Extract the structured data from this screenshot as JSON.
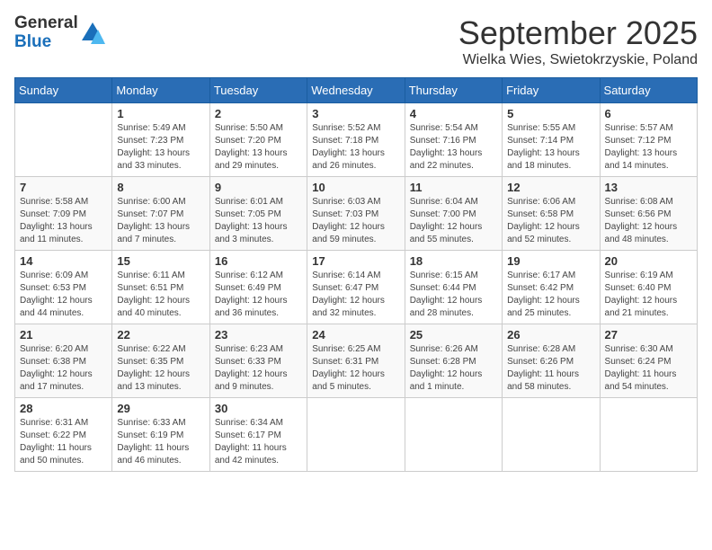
{
  "header": {
    "logo_general": "General",
    "logo_blue": "Blue",
    "month": "September 2025",
    "location": "Wielka Wies, Swietokrzyskie, Poland"
  },
  "days_of_week": [
    "Sunday",
    "Monday",
    "Tuesday",
    "Wednesday",
    "Thursday",
    "Friday",
    "Saturday"
  ],
  "weeks": [
    [
      {
        "num": "",
        "sunrise": "",
        "sunset": "",
        "daylight": ""
      },
      {
        "num": "1",
        "sunrise": "Sunrise: 5:49 AM",
        "sunset": "Sunset: 7:23 PM",
        "daylight": "Daylight: 13 hours and 33 minutes."
      },
      {
        "num": "2",
        "sunrise": "Sunrise: 5:50 AM",
        "sunset": "Sunset: 7:20 PM",
        "daylight": "Daylight: 13 hours and 29 minutes."
      },
      {
        "num": "3",
        "sunrise": "Sunrise: 5:52 AM",
        "sunset": "Sunset: 7:18 PM",
        "daylight": "Daylight: 13 hours and 26 minutes."
      },
      {
        "num": "4",
        "sunrise": "Sunrise: 5:54 AM",
        "sunset": "Sunset: 7:16 PM",
        "daylight": "Daylight: 13 hours and 22 minutes."
      },
      {
        "num": "5",
        "sunrise": "Sunrise: 5:55 AM",
        "sunset": "Sunset: 7:14 PM",
        "daylight": "Daylight: 13 hours and 18 minutes."
      },
      {
        "num": "6",
        "sunrise": "Sunrise: 5:57 AM",
        "sunset": "Sunset: 7:12 PM",
        "daylight": "Daylight: 13 hours and 14 minutes."
      }
    ],
    [
      {
        "num": "7",
        "sunrise": "Sunrise: 5:58 AM",
        "sunset": "Sunset: 7:09 PM",
        "daylight": "Daylight: 13 hours and 11 minutes."
      },
      {
        "num": "8",
        "sunrise": "Sunrise: 6:00 AM",
        "sunset": "Sunset: 7:07 PM",
        "daylight": "Daylight: 13 hours and 7 minutes."
      },
      {
        "num": "9",
        "sunrise": "Sunrise: 6:01 AM",
        "sunset": "Sunset: 7:05 PM",
        "daylight": "Daylight: 13 hours and 3 minutes."
      },
      {
        "num": "10",
        "sunrise": "Sunrise: 6:03 AM",
        "sunset": "Sunset: 7:03 PM",
        "daylight": "Daylight: 12 hours and 59 minutes."
      },
      {
        "num": "11",
        "sunrise": "Sunrise: 6:04 AM",
        "sunset": "Sunset: 7:00 PM",
        "daylight": "Daylight: 12 hours and 55 minutes."
      },
      {
        "num": "12",
        "sunrise": "Sunrise: 6:06 AM",
        "sunset": "Sunset: 6:58 PM",
        "daylight": "Daylight: 12 hours and 52 minutes."
      },
      {
        "num": "13",
        "sunrise": "Sunrise: 6:08 AM",
        "sunset": "Sunset: 6:56 PM",
        "daylight": "Daylight: 12 hours and 48 minutes."
      }
    ],
    [
      {
        "num": "14",
        "sunrise": "Sunrise: 6:09 AM",
        "sunset": "Sunset: 6:53 PM",
        "daylight": "Daylight: 12 hours and 44 minutes."
      },
      {
        "num": "15",
        "sunrise": "Sunrise: 6:11 AM",
        "sunset": "Sunset: 6:51 PM",
        "daylight": "Daylight: 12 hours and 40 minutes."
      },
      {
        "num": "16",
        "sunrise": "Sunrise: 6:12 AM",
        "sunset": "Sunset: 6:49 PM",
        "daylight": "Daylight: 12 hours and 36 minutes."
      },
      {
        "num": "17",
        "sunrise": "Sunrise: 6:14 AM",
        "sunset": "Sunset: 6:47 PM",
        "daylight": "Daylight: 12 hours and 32 minutes."
      },
      {
        "num": "18",
        "sunrise": "Sunrise: 6:15 AM",
        "sunset": "Sunset: 6:44 PM",
        "daylight": "Daylight: 12 hours and 28 minutes."
      },
      {
        "num": "19",
        "sunrise": "Sunrise: 6:17 AM",
        "sunset": "Sunset: 6:42 PM",
        "daylight": "Daylight: 12 hours and 25 minutes."
      },
      {
        "num": "20",
        "sunrise": "Sunrise: 6:19 AM",
        "sunset": "Sunset: 6:40 PM",
        "daylight": "Daylight: 12 hours and 21 minutes."
      }
    ],
    [
      {
        "num": "21",
        "sunrise": "Sunrise: 6:20 AM",
        "sunset": "Sunset: 6:38 PM",
        "daylight": "Daylight: 12 hours and 17 minutes."
      },
      {
        "num": "22",
        "sunrise": "Sunrise: 6:22 AM",
        "sunset": "Sunset: 6:35 PM",
        "daylight": "Daylight: 12 hours and 13 minutes."
      },
      {
        "num": "23",
        "sunrise": "Sunrise: 6:23 AM",
        "sunset": "Sunset: 6:33 PM",
        "daylight": "Daylight: 12 hours and 9 minutes."
      },
      {
        "num": "24",
        "sunrise": "Sunrise: 6:25 AM",
        "sunset": "Sunset: 6:31 PM",
        "daylight": "Daylight: 12 hours and 5 minutes."
      },
      {
        "num": "25",
        "sunrise": "Sunrise: 6:26 AM",
        "sunset": "Sunset: 6:28 PM",
        "daylight": "Daylight: 12 hours and 1 minute."
      },
      {
        "num": "26",
        "sunrise": "Sunrise: 6:28 AM",
        "sunset": "Sunset: 6:26 PM",
        "daylight": "Daylight: 11 hours and 58 minutes."
      },
      {
        "num": "27",
        "sunrise": "Sunrise: 6:30 AM",
        "sunset": "Sunset: 6:24 PM",
        "daylight": "Daylight: 11 hours and 54 minutes."
      }
    ],
    [
      {
        "num": "28",
        "sunrise": "Sunrise: 6:31 AM",
        "sunset": "Sunset: 6:22 PM",
        "daylight": "Daylight: 11 hours and 50 minutes."
      },
      {
        "num": "29",
        "sunrise": "Sunrise: 6:33 AM",
        "sunset": "Sunset: 6:19 PM",
        "daylight": "Daylight: 11 hours and 46 minutes."
      },
      {
        "num": "30",
        "sunrise": "Sunrise: 6:34 AM",
        "sunset": "Sunset: 6:17 PM",
        "daylight": "Daylight: 11 hours and 42 minutes."
      },
      {
        "num": "",
        "sunrise": "",
        "sunset": "",
        "daylight": ""
      },
      {
        "num": "",
        "sunrise": "",
        "sunset": "",
        "daylight": ""
      },
      {
        "num": "",
        "sunrise": "",
        "sunset": "",
        "daylight": ""
      },
      {
        "num": "",
        "sunrise": "",
        "sunset": "",
        "daylight": ""
      }
    ]
  ]
}
